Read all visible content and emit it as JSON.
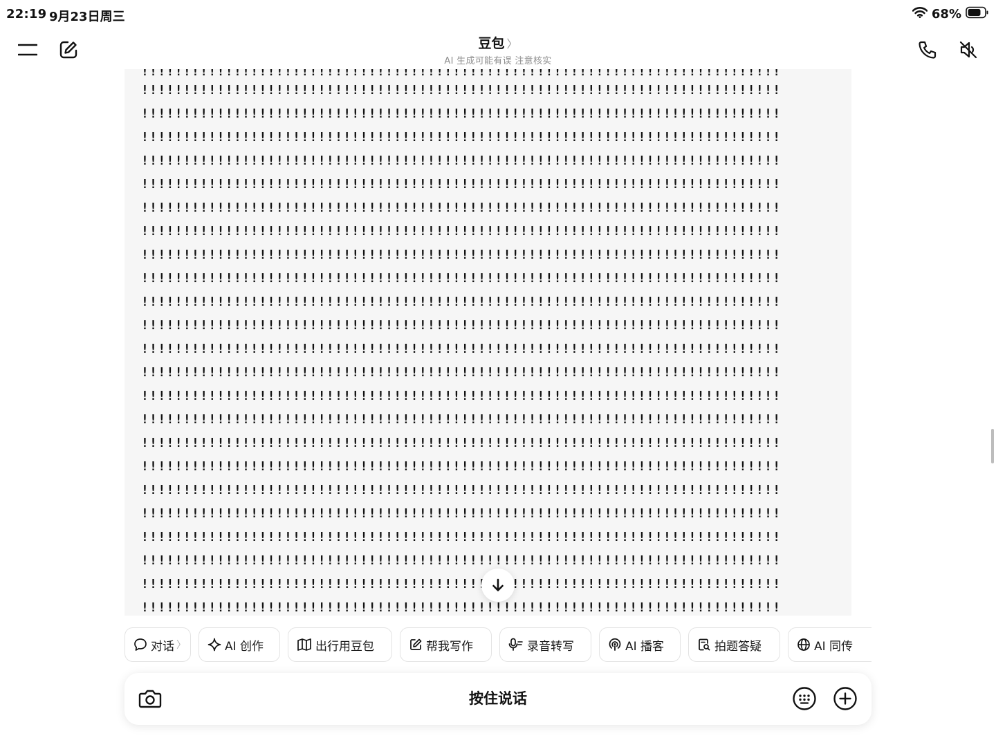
{
  "status_bar": {
    "time": "22:19",
    "date": "9月23日周三",
    "battery": "68%"
  },
  "nav": {
    "title": "豆包",
    "chevron": "〉",
    "subtitle": "AI 生成可能有误 注意核实",
    "icons": [
      "menu-icon",
      "compose-icon",
      "phone-icon",
      "mute-icon"
    ]
  },
  "code_block": {
    "first_line_partial": "!!!!!!!!!!!!!!!!!!!!!!!!!!!!!!!!!!!!!!!!!!!!!!!!!!!!!!!!!!!!!!!!!!!!!!!!!!!!",
    "lines": [
      "!!!!!!!!!!!!!!!!!!!!!!!!!!!!!!!!!!!!!!!!!!!!!!!!!!!!!!!!!!!!!!!!!!!!!!!!!!!!",
      "!!!!!!!!!!!!!!!!!!!!!!!!!!!!!!!!!!!!!!!!!!!!!!!!!!!!!!!!!!!!!!!!!!!!!!!!!!!!",
      "!!!!!!!!!!!!!!!!!!!!!!!!!!!!!!!!!!!!!!!!!!!!!!!!!!!!!!!!!!!!!!!!!!!!!!!!!!!!",
      "!!!!!!!!!!!!!!!!!!!!!!!!!!!!!!!!!!!!!!!!!!!!!!!!!!!!!!!!!!!!!!!!!!!!!!!!!!!!",
      "!!!!!!!!!!!!!!!!!!!!!!!!!!!!!!!!!!!!!!!!!!!!!!!!!!!!!!!!!!!!!!!!!!!!!!!!!!!!",
      "!!!!!!!!!!!!!!!!!!!!!!!!!!!!!!!!!!!!!!!!!!!!!!!!!!!!!!!!!!!!!!!!!!!!!!!!!!!!",
      "!!!!!!!!!!!!!!!!!!!!!!!!!!!!!!!!!!!!!!!!!!!!!!!!!!!!!!!!!!!!!!!!!!!!!!!!!!!!",
      "!!!!!!!!!!!!!!!!!!!!!!!!!!!!!!!!!!!!!!!!!!!!!!!!!!!!!!!!!!!!!!!!!!!!!!!!!!!!",
      "!!!!!!!!!!!!!!!!!!!!!!!!!!!!!!!!!!!!!!!!!!!!!!!!!!!!!!!!!!!!!!!!!!!!!!!!!!!!",
      "!!!!!!!!!!!!!!!!!!!!!!!!!!!!!!!!!!!!!!!!!!!!!!!!!!!!!!!!!!!!!!!!!!!!!!!!!!!!",
      "!!!!!!!!!!!!!!!!!!!!!!!!!!!!!!!!!!!!!!!!!!!!!!!!!!!!!!!!!!!!!!!!!!!!!!!!!!!!",
      "!!!!!!!!!!!!!!!!!!!!!!!!!!!!!!!!!!!!!!!!!!!!!!!!!!!!!!!!!!!!!!!!!!!!!!!!!!!!",
      "!!!!!!!!!!!!!!!!!!!!!!!!!!!!!!!!!!!!!!!!!!!!!!!!!!!!!!!!!!!!!!!!!!!!!!!!!!!!",
      "!!!!!!!!!!!!!!!!!!!!!!!!!!!!!!!!!!!!!!!!!!!!!!!!!!!!!!!!!!!!!!!!!!!!!!!!!!!!",
      "!!!!!!!!!!!!!!!!!!!!!!!!!!!!!!!!!!!!!!!!!!!!!!!!!!!!!!!!!!!!!!!!!!!!!!!!!!!!",
      "!!!!!!!!!!!!!!!!!!!!!!!!!!!!!!!!!!!!!!!!!!!!!!!!!!!!!!!!!!!!!!!!!!!!!!!!!!!!",
      "!!!!!!!!!!!!!!!!!!!!!!!!!!!!!!!!!!!!!!!!!!!!!!!!!!!!!!!!!!!!!!!!!!!!!!!!!!!!",
      "!!!!!!!!!!!!!!!!!!!!!!!!!!!!!!!!!!!!!!!!!!!!!!!!!!!!!!!!!!!!!!!!!!!!!!!!!!!!",
      "!!!!!!!!!!!!!!!!!!!!!!!!!!!!!!!!!!!!!!!!!!!!!!!!!!!!!!!!!!!!!!!!!!!!!!!!!!!!",
      "!!!!!!!!!!!!!!!!!!!!!!!!!!!!!!!!!!!!!!!!!!!!!!!!!!!!!!!!!!!!!!!!!!!!!!!!!!!!",
      "!!!!!!!!!!!!!!!!!!!!!!!!!!!!!!!!!!!!!!!!!!!!!!!!!!!!!!!!!!!!!!!!!!!!!!!!!!!!",
      "!!!!!!!!!!!!!!!!!!!!!!!!!!!!!!!!!!!!!!!!!!!!!!!!!!!!!!!!!!!!!!!!!!!!!!!!!!!!",
      "!!!!!!!!!!!!!!!!!!!!!!!!!!!!!!!!!!!!!!!!!!!!!!!!!!!!!!!!!!!!!!!!!!!!!!!!!!!!",
      "!!!!!!!!!!!!!!!!!!!!!!!!!!!!!!!!!!!!!!!!!!!!!!!!!!!!!!!!!!!!!!!!!!!!!!!!!!!!"
    ]
  },
  "chips": [
    {
      "label": "对话",
      "icon": "chat-bubble-icon",
      "chevron": "〉"
    },
    {
      "label": "AI 创作",
      "icon": "sparkle-icon"
    },
    {
      "label": "出行用豆包",
      "icon": "map-icon"
    },
    {
      "label": "帮我写作",
      "icon": "edit-square-icon"
    },
    {
      "label": "录音转写",
      "icon": "microphone-icon"
    },
    {
      "label": "AI 播客",
      "icon": "podcast-icon"
    },
    {
      "label": "拍题答疑",
      "icon": "document-search-icon"
    },
    {
      "label": "AI 同传",
      "icon": "globe-icon"
    }
  ],
  "input_bar": {
    "hold_to_talk": "按住说话",
    "icons": [
      "camera-icon",
      "keyboard-icon",
      "plus-circle-icon"
    ]
  },
  "colors": {
    "code_block_bg": "#f6f6f6",
    "chip_border": "#e3e3e3",
    "subtitle_gray": "#8e8e8e"
  }
}
